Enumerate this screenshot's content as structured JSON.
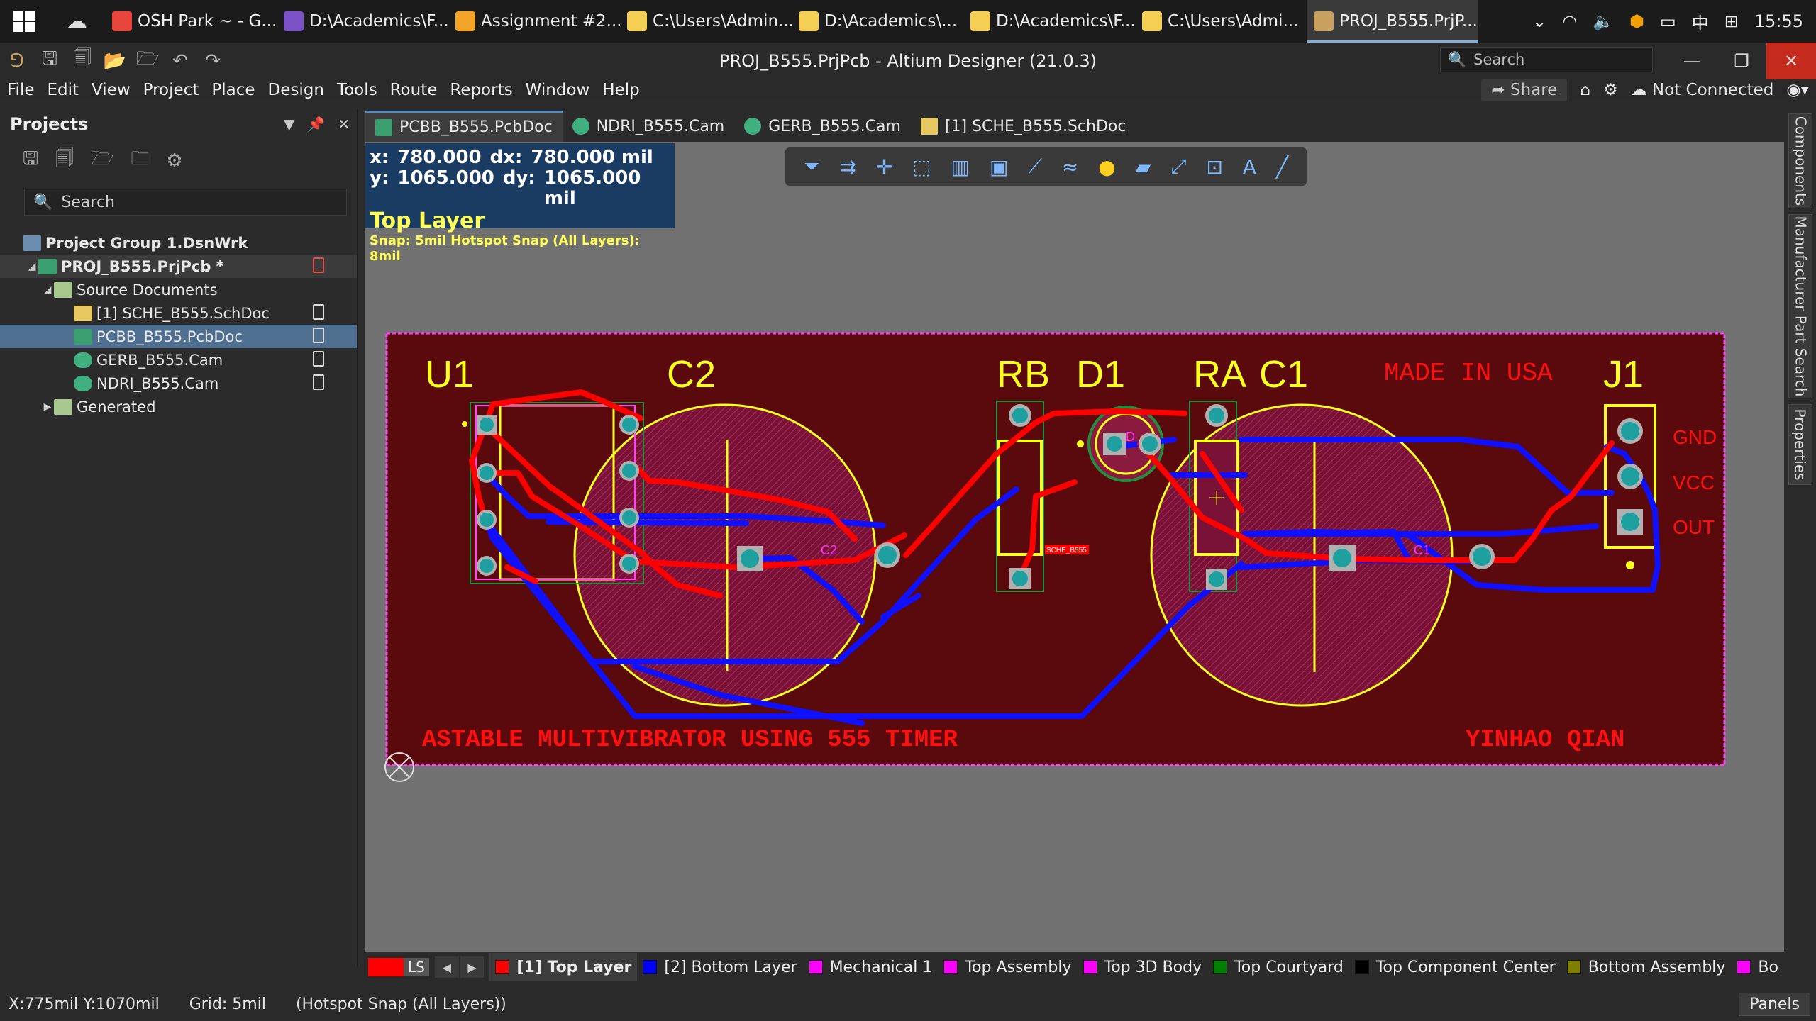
{
  "taskbar": {
    "items": [
      {
        "label": "OSH Park ~ - G...",
        "icon": "chrome-icon",
        "color": "#e8453c"
      },
      {
        "label": "D:\\Academics\\F...",
        "icon": "visual-studio-icon",
        "color": "#7b52c8"
      },
      {
        "label": "Assignment #2...",
        "icon": "google-slides-icon",
        "color": "#f4a427"
      },
      {
        "label": "C:\\Users\\Admin...",
        "icon": "folder-icon",
        "color": "#f5cf53"
      },
      {
        "label": "D:\\Academics\\...",
        "icon": "folder-icon",
        "color": "#f5cf53"
      },
      {
        "label": "D:\\Academics\\F...",
        "icon": "folder-icon",
        "color": "#f5cf53"
      },
      {
        "label": "C:\\Users\\Admi...",
        "icon": "folder-icon",
        "color": "#f5cf53"
      },
      {
        "label": "PROJ_B555.PrjP...",
        "icon": "altium-icon",
        "color": "#c8a060"
      }
    ],
    "ime": "中",
    "time": "15:55"
  },
  "window": {
    "title": "PROJ_B555.PrjPcb - Altium Designer (21.0.3)",
    "search_placeholder": "Search"
  },
  "menu": [
    "File",
    "Edit",
    "View",
    "Project",
    "Place",
    "Design",
    "Tools",
    "Route",
    "Reports",
    "Window",
    "Help"
  ],
  "menu_right": {
    "share": "Share",
    "connection": "Not Connected"
  },
  "projects": {
    "title": "Projects",
    "search_placeholder": "Search",
    "tree": [
      {
        "label": "Project Group 1.DsnWrk",
        "level": 0,
        "bold": true
      },
      {
        "label": "PROJ_B555.PrjPcb *",
        "level": 1,
        "bold": true
      },
      {
        "label": "Source Documents",
        "level": 2
      },
      {
        "label": "[1] SCHE_B555.SchDoc",
        "level": 3
      },
      {
        "label": "PCBB_B555.PcbDoc",
        "level": 3
      },
      {
        "label": "GERB_B555.Cam",
        "level": 3
      },
      {
        "label": "NDRI_B555.Cam",
        "level": 3
      },
      {
        "label": "Generated",
        "level": 2
      }
    ]
  },
  "tabs": [
    "PCBB_B555.PcbDoc",
    "NDRI_B555.Cam",
    "GERB_B555.Cam",
    "[1] SCHE_B555.SchDoc"
  ],
  "coords": {
    "x_label": "x:",
    "x": "780.000",
    "dx_label": "dx:",
    "dx": "780.000 mil",
    "y_label": "y:",
    "y": "1065.000",
    "dy_label": "dy:",
    "dy": "1065.000 mil",
    "layer": "Top Layer",
    "snap": "Snap: 5mil Hotspot Snap (All Layers): 8mil"
  },
  "pcb": {
    "designators": [
      "U1",
      "C2",
      "RB",
      "D1",
      "RA",
      "C1",
      "J1"
    ],
    "pad_labels": [
      "GND",
      "VCC",
      "OUT"
    ],
    "made_in": "MADE IN USA",
    "title": "ASTABLE MULTIVIBRATOR USING 555 TIMER",
    "author": "YINHAO QIAN",
    "small_labels": {
      "c2": "C2",
      "c1": "C1",
      "d": "D",
      "net": "SCHE_B555"
    }
  },
  "right_panels": [
    "Components",
    "Manufacturer Part Search",
    "Properties"
  ],
  "layers": {
    "ls_label": "LS",
    "items": [
      {
        "label": "[1] Top Layer",
        "color": "#ff0000",
        "active": true
      },
      {
        "label": "[2] Bottom Layer",
        "color": "#0000ff"
      },
      {
        "label": "Mechanical 1",
        "color": "#ff00ff"
      },
      {
        "label": "Top Assembly",
        "color": "#ff00ff"
      },
      {
        "label": "Top 3D Body",
        "color": "#ff00ff"
      },
      {
        "label": "Top Courtyard",
        "color": "#008000"
      },
      {
        "label": "Top Component Center",
        "color": "#000000"
      },
      {
        "label": "Bottom Assembly",
        "color": "#808000"
      },
      {
        "label": "Bo",
        "color": "#ff00ff"
      }
    ]
  },
  "status": {
    "pos": "X:775mil Y:1070mil",
    "grid": "Grid: 5mil",
    "snap": "(Hotspot Snap (All Layers))",
    "panels": "Panels"
  }
}
